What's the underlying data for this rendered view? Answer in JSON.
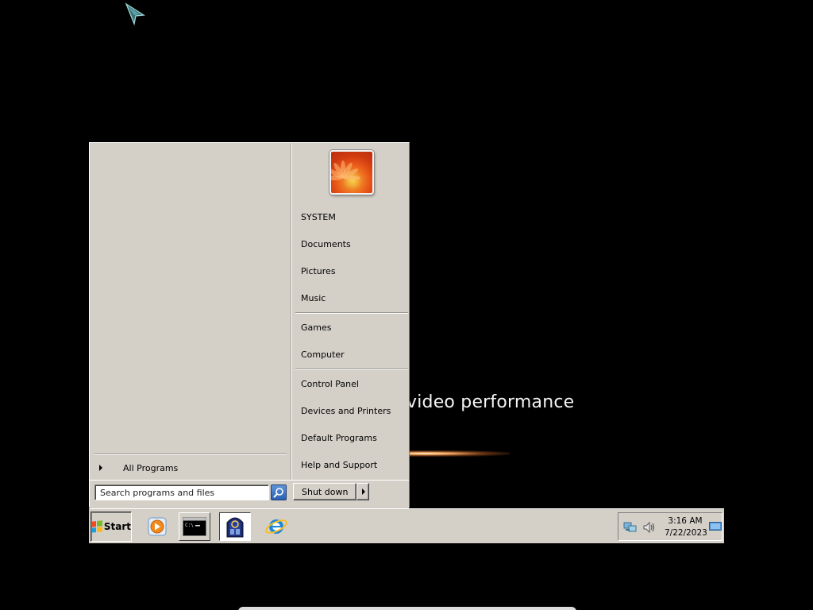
{
  "wallpaper": {
    "text": "video performance"
  },
  "start_menu": {
    "all_programs_label": "All Programs",
    "right_items": [
      {
        "label": "SYSTEM"
      },
      {
        "label": "Documents"
      },
      {
        "label": "Pictures"
      },
      {
        "label": "Music"
      },
      {
        "label": "Games"
      },
      {
        "label": "Computer"
      },
      {
        "label": "Control Panel"
      },
      {
        "label": "Devices and Printers"
      },
      {
        "label": "Default Programs"
      },
      {
        "label": "Help and Support"
      }
    ],
    "search": {
      "placeholder": "Search programs and files",
      "value": ""
    },
    "shutdown_label": "Shut down"
  },
  "taskbar": {
    "start_label": "Start",
    "apps": [
      {
        "name": "windows-media-player",
        "icon": "media-player-icon"
      },
      {
        "name": "command-prompt",
        "icon": "cmd-icon"
      },
      {
        "name": "active-program",
        "icon": "window-app-icon"
      },
      {
        "name": "internet-explorer",
        "icon": "ie-icon"
      }
    ],
    "clock": {
      "time": "3:16 AM",
      "date": "7/22/2023"
    }
  },
  "colors": {
    "menu_face": "#d4d0c8",
    "desktop": "#000000",
    "wallpaper_text": "#f4f4f4"
  }
}
